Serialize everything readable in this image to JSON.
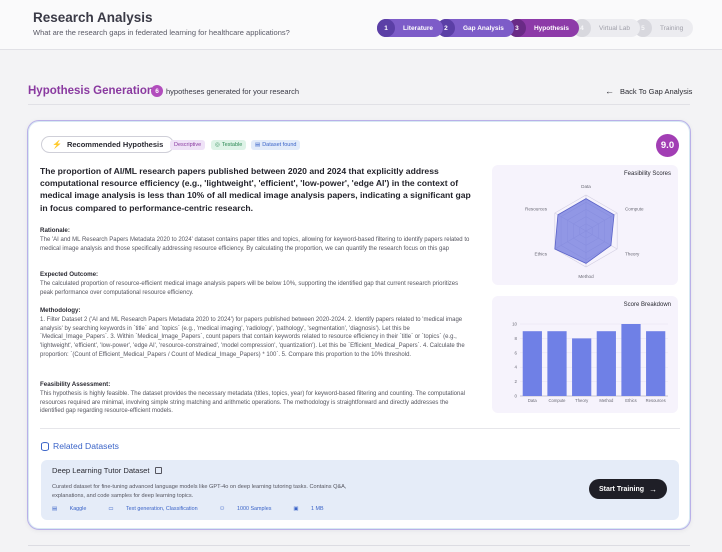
{
  "header": {
    "title": "Research Analysis",
    "subtitle": "What are the research gaps in federated learning for healthcare applications?",
    "steps": [
      {
        "num": "1",
        "label": "Literature",
        "state": "done"
      },
      {
        "num": "2",
        "label": "Gap Analysis",
        "state": "done"
      },
      {
        "num": "3",
        "label": "Hypothesis",
        "state": "current"
      },
      {
        "num": "4",
        "label": "Virtual Lab",
        "state": "todo"
      },
      {
        "num": "5",
        "label": "Training",
        "state": "todo"
      }
    ]
  },
  "section": {
    "title": "Hypothesis Generation",
    "count": "6",
    "count_text": "hypotheses generated for your research",
    "back_label": "Back To Gap Analysis"
  },
  "hypothesis": {
    "badge": "Recommended Hypothesis",
    "tags": [
      "Descriptive",
      "Testable",
      "Dataset found"
    ],
    "score": "9.0",
    "statement": "The proportion of AI/ML research papers published between 2020 and 2024 that explicitly address computational resource efficiency (e.g., 'lightweight', 'efficient', 'low-power', 'edge AI') in the context of medical image analysis is less than 10% of all medical image analysis papers, indicating a significant gap in focus compared to performance-centric research.",
    "rationale_heading": "Rationale:",
    "rationale": "The 'AI and ML Research Papers Metadata 2020 to 2024' dataset contains paper titles and topics, allowing for keyword-based filtering to identify papers related to medical image analysis and those specifically addressing resource efficiency. By calculating the proportion, we can quantify the research focus on this gap",
    "outcome_heading": "Expected Outcome:",
    "outcome": "The calculated proportion of resource-efficient medical image analysis papers will be below 10%, supporting the identified gap that current research prioritizes peak performance over computational resource efficiency.",
    "method_heading": "Methodology:",
    "method": "1. Filter Dataset 2 ('AI and ML Research Papers Metadata 2020 to 2024') for papers published between 2020-2024. 2. Identify papers related to 'medical image analysis' by searching keywords in `title` and `topics` (e.g., 'medical imaging', 'radiology', 'pathology', 'segmentation', 'diagnosis'). Let this be `Medical_Image_Papers`. 3. Within `Medical_Image_Papers`, count papers that contain keywords related to resource efficiency in their `title` or `topics` (e.g., 'lightweight', 'efficient', 'low-power', 'edge AI', 'resource-constrained', 'model compression', 'quantization'). Let this be `Efficient_Medical_Papers`. 4. Calculate the proportion: `(Count of Efficient_Medical_Papers / Count of Medical_Image_Papers) * 100`. 5. Compare this proportion to the 10% threshold.",
    "feas_heading": "Feasibility Assessment:",
    "feas": "This hypothesis is highly feasible. The dataset provides the necessary metadata (titles, topics, year) for keyword-based filtering and counting. The computational resources required are minimal, involving simple string matching and arithmetic operations. The methodology is straightforward and directly addresses the identified gap regarding resource-efficient models."
  },
  "chart_data": [
    {
      "type": "radar",
      "title": "Feasibility Scores",
      "axes": [
        "Data",
        "Compute",
        "Theory",
        "Method",
        "Ethics",
        "Resources"
      ],
      "values": [
        9,
        9,
        8,
        9,
        10,
        9
      ],
      "range": [
        0,
        10
      ]
    },
    {
      "type": "bar",
      "title": "Score Breakdown",
      "categories": [
        "Data",
        "Compute",
        "Theory",
        "Method",
        "Ethics",
        "Resources"
      ],
      "values": [
        9,
        9,
        8,
        9,
        10,
        9
      ],
      "ylim": [
        0,
        10
      ],
      "yticks": [
        0,
        2,
        4,
        6,
        8,
        10
      ],
      "color": "#6f80e6"
    }
  ],
  "related": {
    "heading": "Related Datasets",
    "dataset": {
      "name": "Deep Learning Tutor Dataset",
      "description": "Curated dataset for fine-tuning advanced language models like GPT-4o on deep learning tutoring tasks. Contains Q&A, explanations, and code samples for deep learning topics.",
      "source": "Kaggle",
      "task": "Text generation, Classification",
      "samples": "1000 Samples",
      "size": "1 MB"
    },
    "train_label": "Start Training"
  }
}
